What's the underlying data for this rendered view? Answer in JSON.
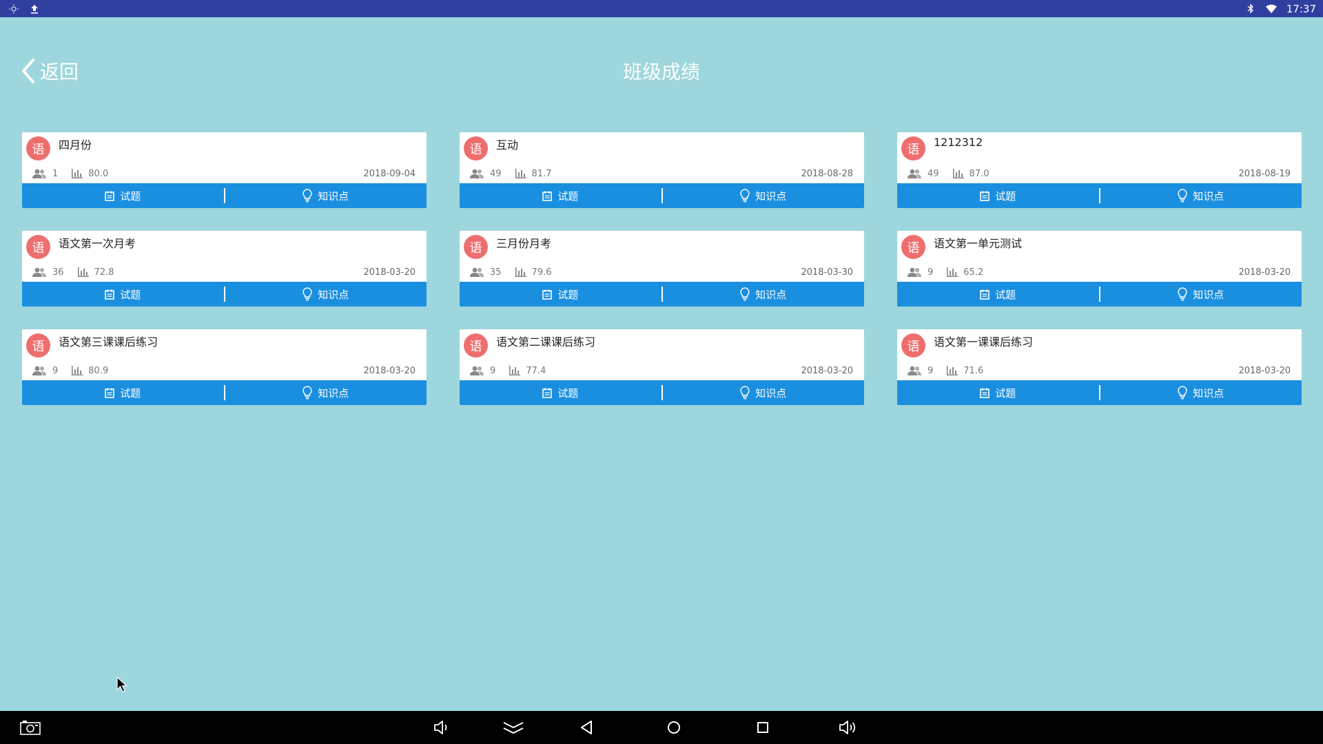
{
  "status_bar": {
    "time": "17:37"
  },
  "header": {
    "back_label": "返回",
    "title": "班级成绩"
  },
  "cards": [
    {
      "badge": "语",
      "title": "四月份",
      "students": "1",
      "score": "80.0",
      "date": "2018-09-04",
      "btn_questions": "试题",
      "btn_knowledge": "知识点"
    },
    {
      "badge": "语",
      "title": "互动",
      "students": "49",
      "score": "81.7",
      "date": "2018-08-28",
      "btn_questions": "试题",
      "btn_knowledge": "知识点"
    },
    {
      "badge": "语",
      "title": "1212312",
      "students": "49",
      "score": "87.0",
      "date": "2018-08-19",
      "btn_questions": "试题",
      "btn_knowledge": "知识点"
    },
    {
      "badge": "语",
      "title": "语文第一次月考",
      "students": "36",
      "score": "72.8",
      "date": "2018-03-20",
      "btn_questions": "试题",
      "btn_knowledge": "知识点"
    },
    {
      "badge": "语",
      "title": "三月份月考",
      "students": "35",
      "score": "79.6",
      "date": "2018-03-30",
      "btn_questions": "试题",
      "btn_knowledge": "知识点"
    },
    {
      "badge": "语",
      "title": "语文第一单元测试",
      "students": "9",
      "score": "65.2",
      "date": "2018-03-20",
      "btn_questions": "试题",
      "btn_knowledge": "知识点"
    },
    {
      "badge": "语",
      "title": "语文第三课课后练习",
      "students": "9",
      "score": "80.9",
      "date": "2018-03-20",
      "btn_questions": "试题",
      "btn_knowledge": "知识点"
    },
    {
      "badge": "语",
      "title": "语文第二课课后练习",
      "students": "9",
      "score": "77.4",
      "date": "2018-03-20",
      "btn_questions": "试题",
      "btn_knowledge": "知识点"
    },
    {
      "badge": "语",
      "title": "语文第一课课后练习",
      "students": "9",
      "score": "71.6",
      "date": "2018-03-20",
      "btn_questions": "试题",
      "btn_knowledge": "知识点"
    }
  ],
  "icons": {
    "status_left": [
      "brightness-icon",
      "upload-icon"
    ],
    "status_right": [
      "bluetooth-icon",
      "wifi-icon"
    ],
    "nav": [
      "screenshot-icon",
      "volume-down-icon",
      "collapse-icon",
      "back-icon",
      "home-icon",
      "recents-icon",
      "volume-up-icon"
    ]
  },
  "colors": {
    "status_bar": "#303f9f",
    "background": "#9dd6dc",
    "badge": "#ee6e6e",
    "action_bar": "#1a8fe0"
  }
}
